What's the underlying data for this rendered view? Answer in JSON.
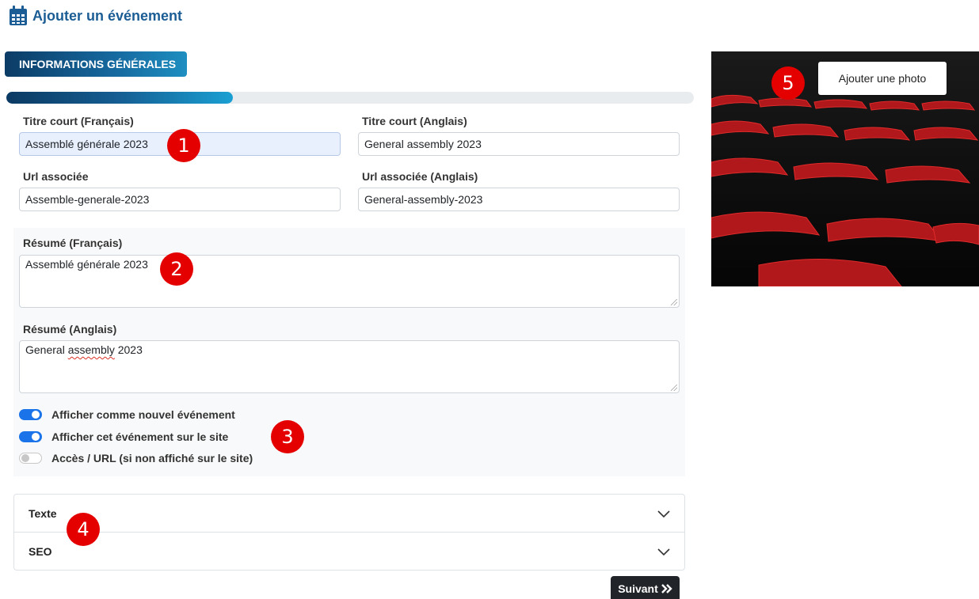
{
  "header": {
    "title": "Ajouter un événement",
    "icon": "calendar-icon"
  },
  "section_tab": {
    "label": "INFORMATIONS GÉNÉRALES"
  },
  "progress": {
    "fraction": 0.33
  },
  "fields": {
    "title_fr": {
      "label": "Titre court (Français)",
      "value": "Assemblé générale 2023"
    },
    "title_en": {
      "label": "Titre court (Anglais)",
      "value": "General assembly 2023"
    },
    "url_fr": {
      "label": "Url associée",
      "value": "Assemble-generale-2023"
    },
    "url_en": {
      "label": "Url associée (Anglais)",
      "value": "General-assembly-2023"
    },
    "summary_fr": {
      "label": "Résumé (Français)",
      "value": "Assemblé générale 2023"
    },
    "summary_en": {
      "label": "Résumé (Anglais)",
      "value_prefix": "General ",
      "value_misspelled": "assembly",
      "value_suffix": " 2023"
    }
  },
  "toggles": [
    {
      "label": "Afficher comme nouvel événement",
      "on": true
    },
    {
      "label": "Afficher cet événement sur le site",
      "on": true
    },
    {
      "label": "Accès / URL (si non affiché sur le site)",
      "on": false
    }
  ],
  "accordion": [
    {
      "label": "Texte",
      "icon": "chevron-down-icon"
    },
    {
      "label": "SEO",
      "icon": "chevron-down-icon"
    }
  ],
  "next_button": {
    "label": "Suivant",
    "icon": "double-chevron-right-icon"
  },
  "photo": {
    "button_label": "Ajouter une photo",
    "accent": "#d31f1f"
  },
  "markers": [
    "1",
    "2",
    "3",
    "4",
    "5"
  ],
  "colors": {
    "primary": "#1b5d94",
    "marker": "#e50000",
    "toggle_on": "#1a73e8"
  }
}
